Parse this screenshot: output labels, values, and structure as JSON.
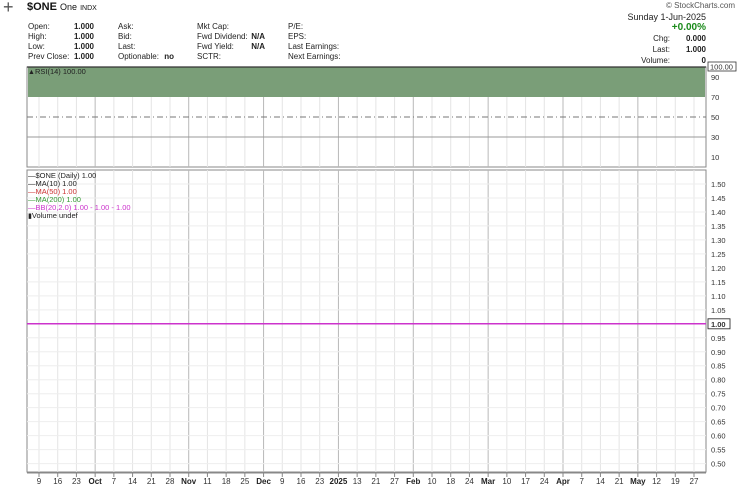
{
  "header": {
    "symbol": "$ONE",
    "name": "One",
    "exchange": "INDX",
    "brand": "© StockCharts.com",
    "date": "Sunday  1-Jun-2025",
    "change_pct": "+0.00%",
    "col1": [
      {
        "k": "Open:",
        "v": "1.000"
      },
      {
        "k": "High:",
        "v": "1.000"
      },
      {
        "k": "Low:",
        "v": "1.000"
      },
      {
        "k": "Prev Close:",
        "v": "1.000"
      }
    ],
    "col2": [
      {
        "k": "Ask:",
        "v": ""
      },
      {
        "k": "Bid:",
        "v": ""
      },
      {
        "k": "Last:",
        "v": ""
      },
      {
        "k": "Optionable:",
        "v": "no"
      }
    ],
    "col3": [
      {
        "k": "Mkt Cap:",
        "v": ""
      },
      {
        "k": "Fwd Dividend:",
        "v": "N/A"
      },
      {
        "k": "Fwd Yield:",
        "v": "N/A"
      },
      {
        "k": "SCTR:",
        "v": ""
      }
    ],
    "col4": [
      {
        "k": "P/E:",
        "v": ""
      },
      {
        "k": "EPS:",
        "v": ""
      },
      {
        "k": "Last Earnings:",
        "v": ""
      },
      {
        "k": "Next Earnings:",
        "v": ""
      }
    ],
    "right": [
      {
        "k": "Chg:",
        "v": "0.000"
      },
      {
        "k": "Last:",
        "v": "1.000"
      },
      {
        "k": "Volume:",
        "v": "0"
      }
    ]
  },
  "legend": {
    "rsi": "RSI(14) 100.00",
    "price": "$ONE (Daily) 1.00",
    "ma10": "MA(10) 1.00",
    "ma50": "MA(50) 1.00",
    "ma200": "MA(200) 1.00",
    "bb": "BB(20,2.0) 1.00 - 1.00 - 1.00",
    "volume": "Volume undef"
  },
  "colors": {
    "rsi_fill": "#7a9e78",
    "price_line": "#cc33cc",
    "ma50": "#cc3333",
    "ma200": "#339933",
    "bb": "#cc33cc",
    "change_green": "#1a8a1a"
  },
  "chart_data": [
    {
      "type": "area",
      "name_label": "RSI(14)",
      "ylim": [
        0,
        100
      ],
      "ytick_labels": [
        "100.00",
        "90",
        "70",
        "50",
        "30",
        "10"
      ],
      "ytick_values": [
        100,
        90,
        70,
        50,
        30,
        10
      ],
      "reference_lines": [
        70,
        50,
        30
      ],
      "value": 100.0,
      "current_label": "100.00"
    },
    {
      "type": "line",
      "name_label": "$ONE (Daily)",
      "ylim": [
        0.47,
        1.55
      ],
      "ytick_labels": [
        "1.50",
        "1.45",
        "1.40",
        "1.35",
        "1.30",
        "1.25",
        "1.20",
        "1.15",
        "1.10",
        "1.05",
        "1.00",
        "0.95",
        "0.90",
        "0.85",
        "0.80",
        "0.75",
        "0.70",
        "0.65",
        "0.60",
        "0.55",
        "0.50"
      ],
      "ytick_values": [
        1.5,
        1.45,
        1.4,
        1.35,
        1.3,
        1.25,
        1.2,
        1.15,
        1.1,
        1.05,
        1.0,
        0.95,
        0.9,
        0.85,
        0.8,
        0.75,
        0.7,
        0.65,
        0.6,
        0.55,
        0.5
      ],
      "current_label": "1.00",
      "series": [
        {
          "name": "$ONE (Daily)",
          "value": 1.0
        },
        {
          "name": "MA(10)",
          "value": 1.0
        },
        {
          "name": "MA(50)",
          "value": 1.0
        },
        {
          "name": "MA(200)",
          "value": 1.0
        },
        {
          "name": "BB(20,2.0)",
          "value": 1.0
        }
      ]
    }
  ],
  "x_axis": {
    "labels": [
      "9",
      "16",
      "23",
      "Oct",
      "7",
      "14",
      "21",
      "28",
      "Nov",
      "11",
      "18",
      "25",
      "Dec",
      "9",
      "16",
      "23",
      "2025",
      "13",
      "21",
      "27",
      "Feb",
      "10",
      "18",
      "24",
      "Mar",
      "10",
      "17",
      "24",
      "Apr",
      "7",
      "14",
      "21",
      "May",
      "12",
      "19",
      "27"
    ],
    "major": [
      "Oct",
      "Nov",
      "Dec",
      "2025",
      "Feb",
      "Mar",
      "Apr",
      "May"
    ]
  }
}
